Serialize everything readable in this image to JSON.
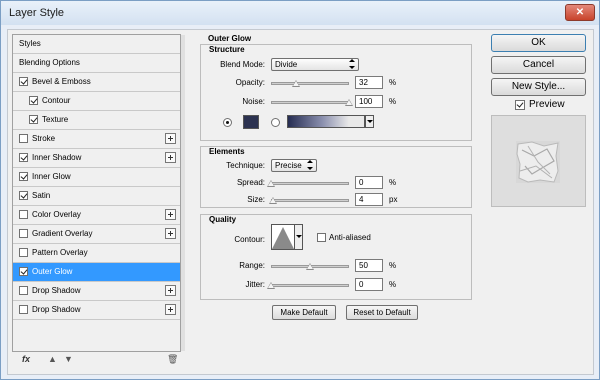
{
  "window": {
    "title": "Layer Style",
    "close_icon": "close-icon"
  },
  "styles_list": [
    {
      "label": "Styles",
      "checkbox": false,
      "checked": false,
      "plus": false,
      "indent": false,
      "selected": false
    },
    {
      "label": "Blending Options",
      "checkbox": false,
      "checked": false,
      "plus": false,
      "indent": false,
      "selected": false
    },
    {
      "label": "Bevel & Emboss",
      "checkbox": true,
      "checked": true,
      "plus": false,
      "indent": false,
      "selected": false
    },
    {
      "label": "Contour",
      "checkbox": true,
      "checked": true,
      "plus": false,
      "indent": true,
      "selected": false
    },
    {
      "label": "Texture",
      "checkbox": true,
      "checked": true,
      "plus": false,
      "indent": true,
      "selected": false
    },
    {
      "label": "Stroke",
      "checkbox": true,
      "checked": false,
      "plus": true,
      "indent": false,
      "selected": false
    },
    {
      "label": "Inner Shadow",
      "checkbox": true,
      "checked": true,
      "plus": true,
      "indent": false,
      "selected": false
    },
    {
      "label": "Inner Glow",
      "checkbox": true,
      "checked": true,
      "plus": false,
      "indent": false,
      "selected": false
    },
    {
      "label": "Satin",
      "checkbox": true,
      "checked": true,
      "plus": false,
      "indent": false,
      "selected": false
    },
    {
      "label": "Color Overlay",
      "checkbox": true,
      "checked": false,
      "plus": true,
      "indent": false,
      "selected": false
    },
    {
      "label": "Gradient Overlay",
      "checkbox": true,
      "checked": false,
      "plus": true,
      "indent": false,
      "selected": false
    },
    {
      "label": "Pattern Overlay",
      "checkbox": true,
      "checked": false,
      "plus": false,
      "indent": false,
      "selected": false
    },
    {
      "label": "Outer Glow",
      "checkbox": true,
      "checked": true,
      "plus": false,
      "indent": false,
      "selected": true
    },
    {
      "label": "Drop Shadow",
      "checkbox": true,
      "checked": false,
      "plus": true,
      "indent": false,
      "selected": false
    },
    {
      "label": "Drop Shadow",
      "checkbox": true,
      "checked": false,
      "plus": true,
      "indent": false,
      "selected": false
    }
  ],
  "bottom_icons": {
    "fx": "fx",
    "fx_icon": "fx-icon",
    "up_icon": "arrow-up-icon",
    "down_icon": "arrow-down-icon",
    "trash_icon": "trash-icon"
  },
  "outer_glow": {
    "title": "Outer Glow",
    "structure": {
      "title": "Structure",
      "blend_mode_label": "Blend Mode:",
      "blend_mode_value": "Divide",
      "opacity_label": "Opacity:",
      "opacity_value": "32",
      "opacity_fraction": 0.32,
      "noise_label": "Noise:",
      "noise_value": "100",
      "noise_fraction": 1.0,
      "unit_percent": "%",
      "color_swatch": "#2c3250",
      "color_mode": "solid"
    },
    "elements": {
      "title": "Elements",
      "technique_label": "Technique:",
      "technique_value": "Precise",
      "spread_label": "Spread:",
      "spread_value": "0",
      "spread_fraction": 0.0,
      "size_label": "Size:",
      "size_value": "4",
      "size_unit": "px",
      "size_fraction": 0.02
    },
    "quality": {
      "title": "Quality",
      "contour_label": "Contour:",
      "anti_aliased_label": "Anti-aliased",
      "anti_aliased_checked": false,
      "range_label": "Range:",
      "range_value": "50",
      "range_fraction": 0.5,
      "jitter_label": "Jitter:",
      "jitter_value": "0",
      "jitter_fraction": 0.0
    },
    "make_default": "Make Default",
    "reset_default": "Reset to Default"
  },
  "right_panel": {
    "ok": "OK",
    "cancel": "Cancel",
    "new_style": "New Style...",
    "preview_label": "Preview",
    "preview_checked": true
  }
}
